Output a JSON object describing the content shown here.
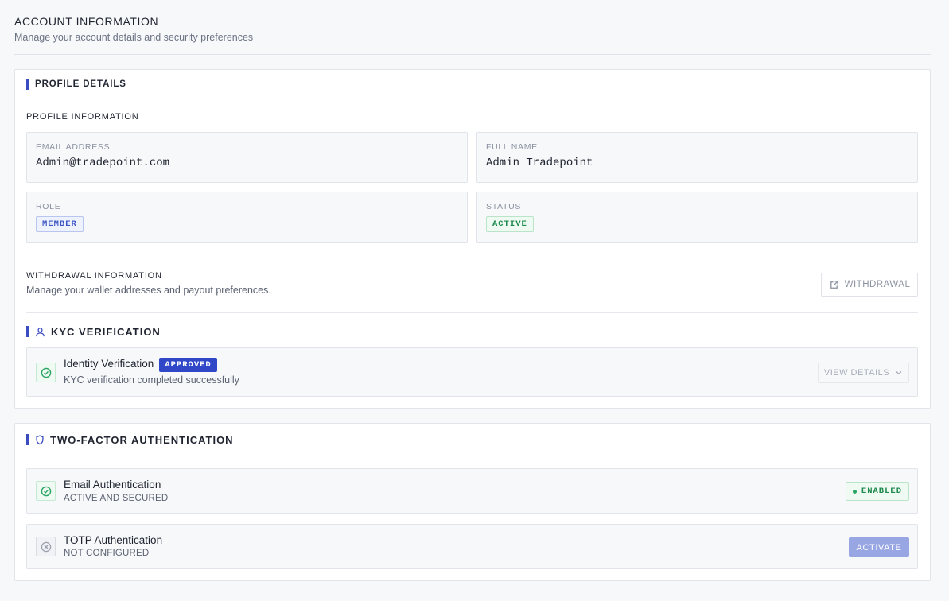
{
  "header": {
    "title": "ACCOUNT INFORMATION",
    "subtitle": "Manage your account details and security preferences"
  },
  "profile_card": {
    "title": "PROFILE DETAILS",
    "section_label": "PROFILE INFORMATION",
    "email": {
      "label": "EMAIL ADDRESS",
      "value": "Admin@tradepoint.com"
    },
    "full_name": {
      "label": "FULL NAME",
      "value": "Admin Tradepoint"
    },
    "role": {
      "label": "ROLE",
      "value": "MEMBER"
    },
    "status": {
      "label": "STATUS",
      "value": "ACTIVE"
    },
    "withdrawal": {
      "title": "WITHDRAWAL INFORMATION",
      "description": "Manage your wallet addresses and payout preferences.",
      "button_label": "WITHDRAWAL",
      "button_icon": "external-link-icon"
    },
    "kyc": {
      "title": "KYC VERIFICATION",
      "icon": "user-icon",
      "item": {
        "title": "Identity Verification",
        "badge": "APPROVED",
        "description": "KYC verification completed successfully",
        "button_label": "VIEW DETAILS",
        "icon": "check-circle-icon"
      }
    }
  },
  "two_factor_card": {
    "title": "TWO-FACTOR AUTHENTICATION",
    "icon": "shield-icon",
    "items": [
      {
        "title": "Email Authentication",
        "subtitle": "ACTIVE AND SECURED",
        "status": "ENABLED",
        "icon": "check-circle-icon"
      },
      {
        "title": "TOTP Authentication",
        "subtitle": "NOT CONFIGURED",
        "action": "ACTIVATE",
        "icon": "x-circle-icon"
      }
    ]
  },
  "colors": {
    "accent": "#3b4cc0",
    "success": "#1e8a4e",
    "approved_bg": "#3048c8",
    "activate_bg": "#98a6e3"
  }
}
